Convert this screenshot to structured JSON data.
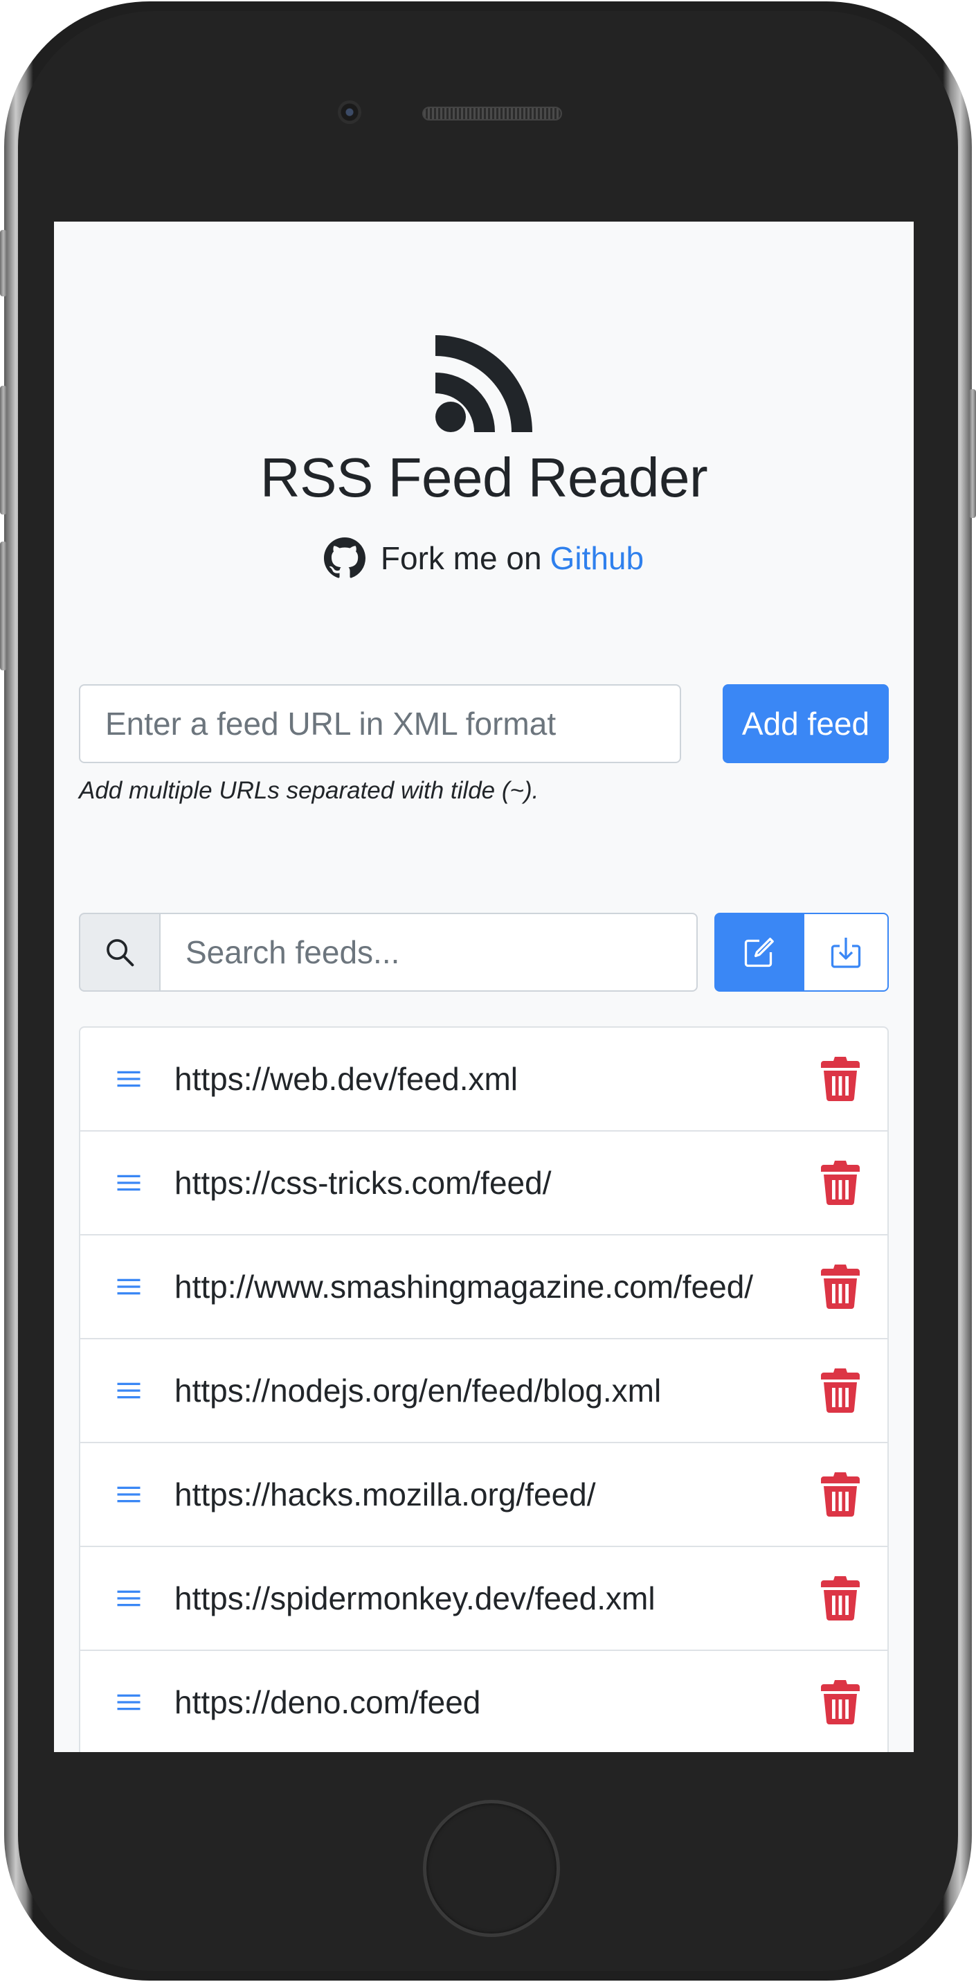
{
  "app": {
    "title": "RSS Feed Reader",
    "fork_text": "Fork me on",
    "github_link": "Github"
  },
  "add_feed": {
    "placeholder": "Enter a feed URL in XML format",
    "button_label": "Add feed",
    "help_text": "Add multiple URLs separated with tilde (~)."
  },
  "search": {
    "placeholder": "Search feeds..."
  },
  "feeds": [
    {
      "url": "https://web.dev/feed.xml"
    },
    {
      "url": "https://css-tricks.com/feed/"
    },
    {
      "url": "http://www.smashingmagazine.com/feed/"
    },
    {
      "url": "https://nodejs.org/en/feed/blog.xml"
    },
    {
      "url": "https://hacks.mozilla.org/feed/"
    },
    {
      "url": "https://spidermonkey.dev/feed.xml"
    },
    {
      "url": "https://deno.com/feed"
    }
  ],
  "icons": {
    "logo": "rss-icon",
    "github": "github-icon",
    "search": "search-icon",
    "edit": "edit-icon",
    "download": "download-icon",
    "drag": "drag-handle-icon",
    "delete": "trash-icon"
  },
  "colors": {
    "primary": "#3a87f5",
    "danger": "#dc3545",
    "link": "#2f80ed",
    "background": "#f8f9fa",
    "text": "#212529"
  }
}
